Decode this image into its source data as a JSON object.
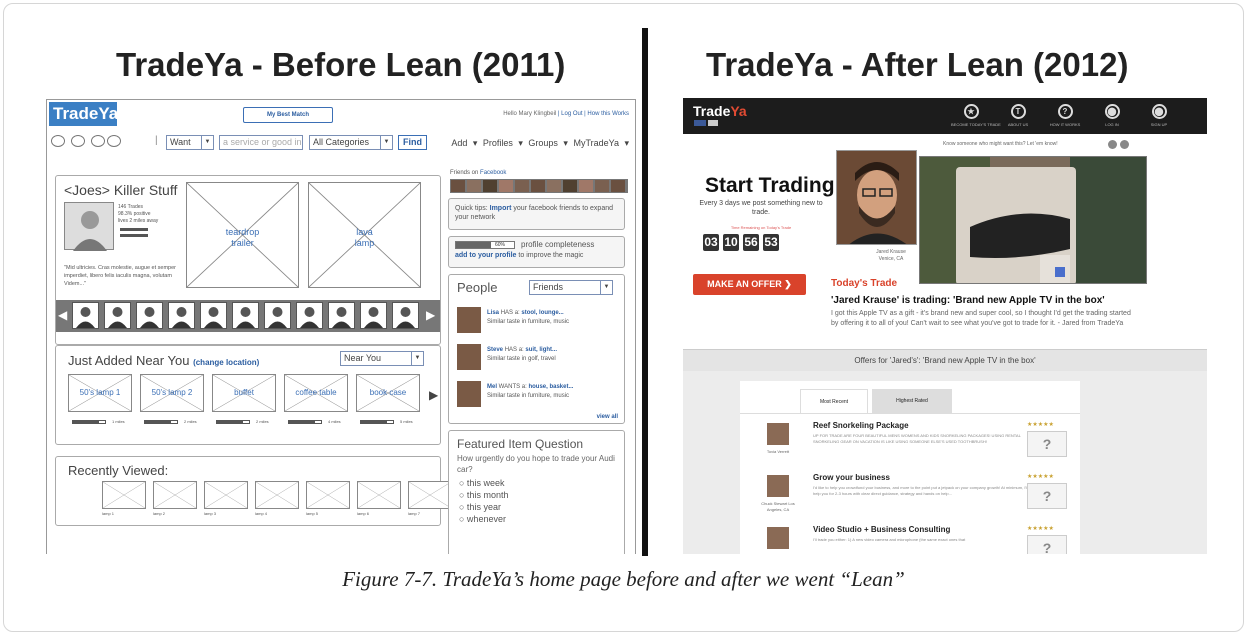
{
  "left_title": "TradeYa - Before Lean (2011)",
  "right_title": "TradeYa - After Lean (2012)",
  "caption": "Figure 7-7. TradeYa’s home page before and after we went “Lean”",
  "before": {
    "logo": "TradeYa",
    "best_match": "My Best Match",
    "greeting": "Hello Mary Klingbeil",
    "logout": "Log Out",
    "how_works": "How this Works",
    "want": "Want",
    "search_placeholder": "a service or good in",
    "category": "All Categories",
    "find": "Find",
    "menu": "Add ▾  Profiles ▾  Groups ▾  MyTradeYa ▾",
    "killer_title": "<Joes> Killer Stuff",
    "profile_stats": "146 Trades\n98.3% positive\nlives 2 miles away",
    "quote": "\"Mid ultricies. Cras molestie, augue et semper imperdiet, libero felis iaculis magna, volutam Videm...\"",
    "item1": "teardrop\ntrailer",
    "item2": "lava\nlamp",
    "friends_on": "Friends on",
    "facebook": "Facebook",
    "quick_tips": "Quick tips:",
    "import": "Import",
    "quick_tips_rest": "your facebook friends to expand your network",
    "completeness_pct": "60%",
    "completeness_label": "profile completeness",
    "add_profile": "add to your profile",
    "improve": "to improve the magic",
    "just_added": "Just Added Near You",
    "change_location": "(change location)",
    "near_you": "Near You",
    "near_items": [
      "50's lamp 1",
      "50's lamp 2",
      "buffet",
      "coffee table",
      "book case"
    ],
    "near_distances": [
      "1 miles",
      "2 miles",
      "2 miles",
      "4 miles",
      "5 miles"
    ],
    "recently_viewed": "Recently Viewed:",
    "recent_items": [
      "lamp 1",
      "lamp 2",
      "lamp 3",
      "lamp 4",
      "lamp 5",
      "lamp 6",
      "lamp 7"
    ],
    "people_title": "People",
    "people_filter": "Friends",
    "people": [
      {
        "name": "Lisa",
        "verb": "HAS a:",
        "things": "stool, lounge...",
        "note": "Similar taste in furniture, music"
      },
      {
        "name": "Steve",
        "verb": "HAS a:",
        "things": "suit, light...",
        "note": "Similar taste in golf, travel"
      },
      {
        "name": "Mel",
        "verb": "WANTS a:",
        "things": "house, basket...",
        "note": "Similar taste in furniture, music"
      }
    ],
    "view_all": "view all",
    "featured_title": "Featured Item Question",
    "featured_q": "How urgently do you hope to trade your Audi car?",
    "options": [
      "this week",
      "this month",
      "this year",
      "whenever"
    ]
  },
  "after": {
    "brand_a": "Trade",
    "brand_b": "Ya",
    "nav": [
      "BECOME TODAY'S TRADE",
      "ABOUT US",
      "HOW IT WORKS",
      "LOG IN",
      "SIGN UP"
    ],
    "nav_icons": [
      "star-icon",
      "trade-icon",
      "help-icon",
      "lock-icon",
      "user-icon"
    ],
    "know_someone": "Know someone who might want this? Let 'em know!",
    "start_trading": "Start Trading!",
    "every_days": "Every 3 days we post something new to trade.",
    "time_remaining": "Time Remaining on Today's Trade",
    "timer": [
      "03",
      "10",
      "56",
      "53"
    ],
    "make_offer": "MAKE AN OFFER ❯",
    "person_name": "Jared Krause",
    "person_loc": "Venice, CA",
    "todays_trade": "Today's Trade",
    "trading_line": "'Jared Krause' is trading: 'Brand new Apple TV in the box'",
    "description": "I got this Apple TV as a gift - it's brand new and super cool, so I thought I'd get the trading started by offering it to all of you! Can't wait to see what you've got to trade for it. - Jared from TradeYa",
    "offers_for": "Offers for 'Jared's': 'Brand new Apple TV in the box'",
    "tab_recent": "Most Recent",
    "tab_rated": "Highest Rated",
    "offers": [
      {
        "title": "Reef Snorkeling Package",
        "desc": "UP FOR TRADE ARE FOUR BEAUTIFUL MENS WOMENS AND KIDS SNORKELING PACKAGES! USING RENTAL SNORKELING GEAR ON VACATION IS LIKE USING SOMEONE ELSE'S USED TOOTHBRUSH!",
        "person": "Tovia Verrett"
      },
      {
        "title": "Grow your business",
        "desc": "I'd like to help you crowdfund your business, and more to the point put a jetpack on your company growth! At minimum, I'll help you for 2-3 hours with clear direct guidance, strategy and hands on help...",
        "person": "Chuck Stewart Los Angeles, CA"
      },
      {
        "title": "Video Studio + Business Consulting",
        "desc": "I'll trade you either: 1) A new video camera and microphone (the same exact ones that",
        "person": ""
      }
    ],
    "question_mark": "?",
    "stars": "★★★★★"
  }
}
